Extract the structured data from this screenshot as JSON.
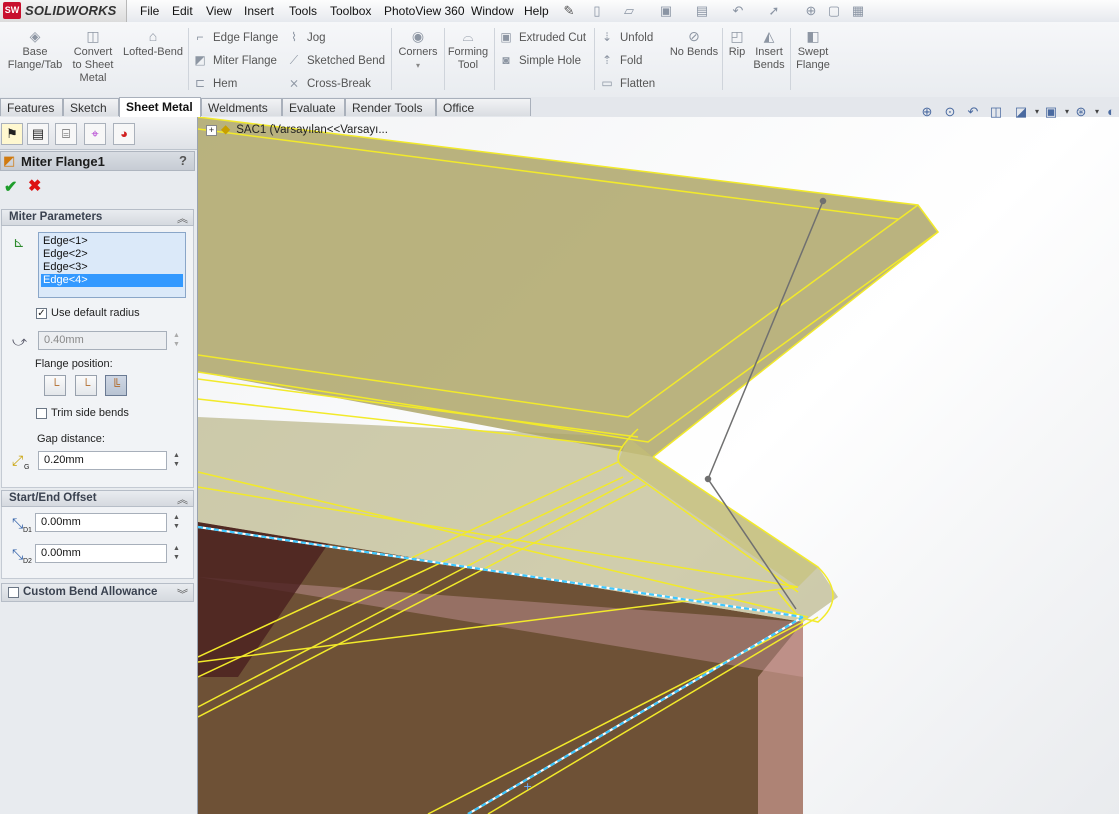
{
  "app": {
    "name": "SOLIDWORKS",
    "logo_mark": "SW"
  },
  "menu": [
    "File",
    "Edit",
    "View",
    "Insert",
    "Tools",
    "Toolbox",
    "PhotoView 360",
    "Window",
    "Help"
  ],
  "quick_access_icons": [
    "pin-icon",
    "new-document-icon",
    "open-icon",
    "save-icon",
    "print-icon",
    "undo-icon",
    "select-icon",
    "rebuild-icon",
    "options-icon"
  ],
  "ribbon": {
    "base_flange": "Base\nFlange/Tab",
    "convert_to_sheet_metal": "Convert\nto Sheet\nMetal",
    "lofted_bend": "Lofted-Bend",
    "edge_flange": "Edge Flange",
    "miter_flange": "Miter Flange",
    "hem": "Hem",
    "jog": "Jog",
    "sketched_bend": "Sketched Bend",
    "cross_break": "Cross-Break",
    "corners": "Corners",
    "forming_tool": "Forming\nTool",
    "extruded_cut": "Extruded Cut",
    "simple_hole": "Simple Hole",
    "unfold": "Unfold",
    "fold": "Fold",
    "flatten": "Flatten",
    "no_bends": "No Bends",
    "rip": "Rip",
    "insert_bends": "Insert\nBends",
    "swept_flange": "Swept\nFlange"
  },
  "tabs": [
    "Features",
    "Sketch",
    "Sheet Metal",
    "Weldments",
    "Evaluate",
    "Render Tools",
    "Office Products"
  ],
  "active_tab": "Sheet Metal",
  "property_manager": {
    "title": "Miter Flange1",
    "help": "?",
    "miter_parameters": {
      "header": "Miter Parameters",
      "edges": [
        "Edge<1>",
        "Edge<2>",
        "Edge<3>",
        "Edge<4>"
      ],
      "selected_edge": "Edge<4>",
      "use_default_radius_label": "Use default radius",
      "use_default_radius": true,
      "radius": "0.40mm",
      "flange_position_label": "Flange position:",
      "trim_side_bends_label": "Trim side bends",
      "trim_side_bends": false,
      "gap_distance_label": "Gap distance:",
      "gap_distance": "0.20mm"
    },
    "start_end_offset": {
      "header": "Start/End Offset",
      "d1": "0.00mm",
      "d2": "0.00mm",
      "d1_tag": "D1",
      "d2_tag": "D2",
      "g_tag": "G"
    },
    "custom_bend_allowance": {
      "header": "Custom Bend Allowance"
    }
  },
  "feature_tree": {
    "root": "SAC1  (Varsayılan<<Varsayı..."
  },
  "colors": {
    "highlight_yellow": "#f2ea2a",
    "part_brown": "#6b4c31",
    "selection_blue": "#3399ff"
  }
}
